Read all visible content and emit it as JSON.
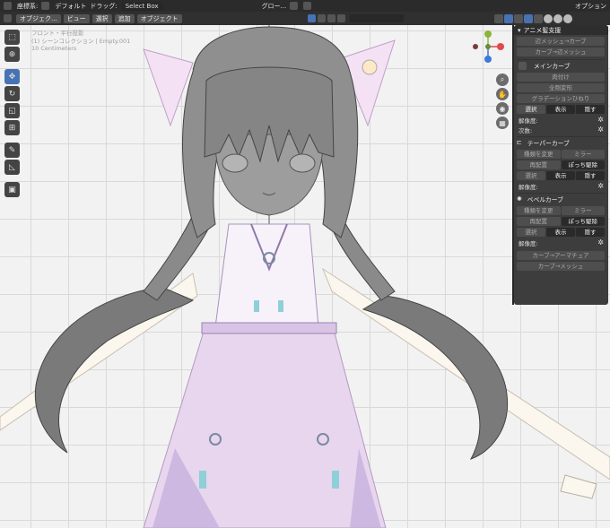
{
  "topbar": {
    "coord_label": "座標系:",
    "pivot_label": "デフォルト",
    "drag_label": "ドラッグ:",
    "select_mode": "Select Box",
    "transform_label": "グロー...",
    "options_label": "オプション"
  },
  "subbar": {
    "mode": "オブジェク...",
    "menus": [
      "ビュー",
      "選択",
      "追加",
      "オブジェクト"
    ]
  },
  "viewport_info": {
    "line1": "フロント・平行投影",
    "line2": "(1) シーンコレクション | Empty.001",
    "line3": "10 Centimeters"
  },
  "gizmo": {
    "x_label": "X",
    "y_label": "Y",
    "z_label": "Z"
  },
  "panel": {
    "title": "アニメ髪支援",
    "top_buttons": [
      "辺メッシュ→カーブ",
      "カーブ→辺メッシュ"
    ],
    "main_curve": {
      "header": "メインカーブ",
      "btn_attach": "肉付け",
      "btn_deform": "全剛変形",
      "btn_twist": "グラデーションひねり",
      "select": "選択",
      "show": "表示",
      "hide": "隠す",
      "resolution_label": "解像度:",
      "order_label": "次数:"
    },
    "taper": {
      "header": "テーパーカーブ",
      "change_type": "種類を変更",
      "mirror": "ミラー",
      "rearrange": "再配置",
      "cut": "ぽっち駆除",
      "select": "選択",
      "show": "表示",
      "hide": "隠す",
      "resolution_label": "解像度:"
    },
    "bevel": {
      "header": "ベベルカーブ",
      "change_type": "種類を変更",
      "mirror": "ミラー",
      "rearrange": "再配置",
      "cut": "ぽっち駆除",
      "select": "選択",
      "show": "表示",
      "hide": "隠す",
      "resolution_label": "解像度:"
    },
    "bottom_buttons": [
      "カーブ→アーマチュア",
      "カーブ→メッシュ"
    ]
  },
  "colors": {
    "accent": "#4772b3",
    "panel_bg": "#3d3d3d",
    "header_bg": "#2b2b2b",
    "grid": "#d9d9d9"
  },
  "icons": [
    "cursor-icon",
    "move-icon",
    "rotate-icon",
    "scale-icon",
    "transform-icon",
    "annotate-icon",
    "measure-icon",
    "add-cube-icon",
    "zoom-icon",
    "hand-icon",
    "camera-icon",
    "grid-icon"
  ]
}
